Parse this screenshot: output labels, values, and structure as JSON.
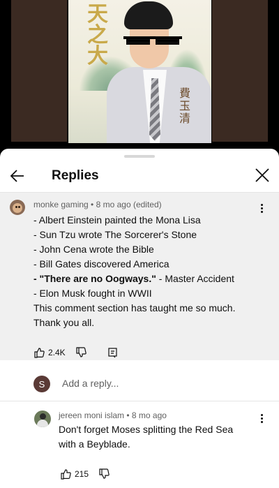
{
  "video": {
    "poster_title": "天之大",
    "poster_name": "費玉清"
  },
  "sheet": {
    "title": "Replies",
    "back_icon": "arrow-back-icon",
    "close_icon": "close-icon"
  },
  "parent_comment": {
    "author": "monke gaming",
    "time": "8 mo ago (edited)",
    "lines": [
      "- Albert Einstein painted the Mona Lisa",
      "- Sun Tzu wrote The Sorcerer's Stone",
      "- John Cena wrote the Bible",
      "- Bill Gates discovered America",
      "- \"There are no Oogways.\"",
      " - Master Accident",
      "- Elon Musk fought in WWII",
      "This comment section has taught me so much.",
      "Thank you all."
    ],
    "likes": "2.4K"
  },
  "reply_box": {
    "avatar_letter": "S",
    "placeholder": "Add a reply..."
  },
  "replies": [
    {
      "author": "jereen moni islam",
      "time": "8 mo ago",
      "text_lines": [
        "Don't forget Moses splitting the Red Sea",
        "with a Beyblade."
      ],
      "likes": "215"
    }
  ],
  "separator": " • ",
  "colors": {
    "sheet_bg": "#ffffff",
    "highlight_bg": "#f0f0f0",
    "primary_text": "#0f0f0f",
    "secondary_text": "#606060"
  }
}
